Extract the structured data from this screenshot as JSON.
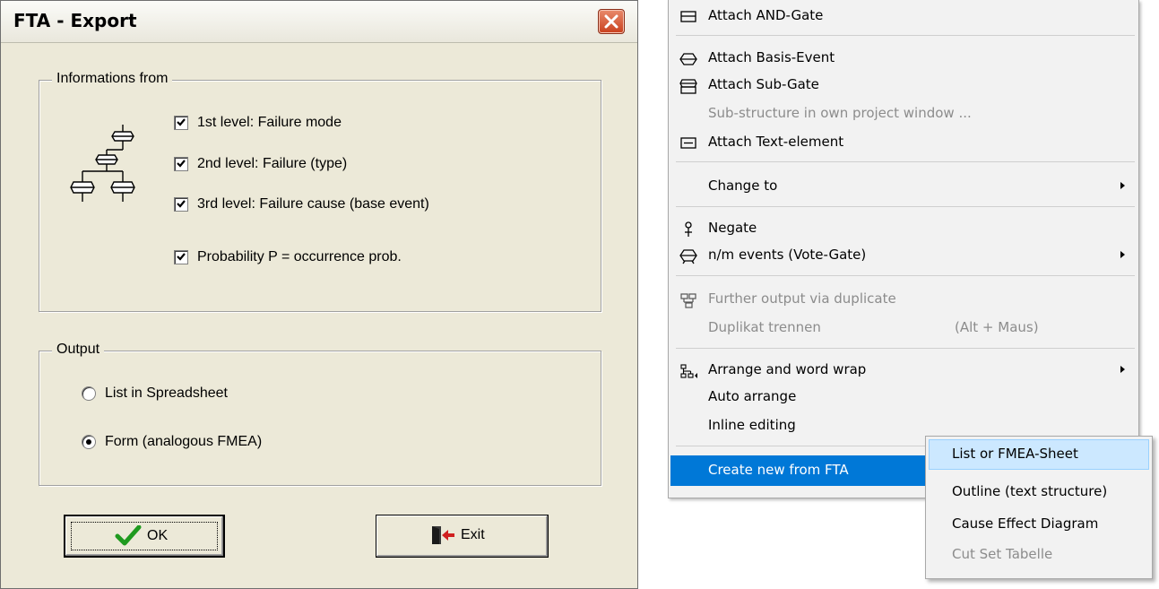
{
  "dialog": {
    "title": "FTA - Export",
    "info_group": {
      "legend": "Informations from",
      "checkboxes": [
        {
          "label": "1st level:  Failure mode",
          "checked": true
        },
        {
          "label": "2nd level: Failure (type)",
          "checked": true
        },
        {
          "label": "3rd level:  Failure cause (base event)",
          "checked": true
        },
        {
          "label": "Probability P = occurrence prob.",
          "checked": true
        }
      ]
    },
    "output_group": {
      "legend": "Output",
      "options": [
        {
          "label": "List in Spreadsheet",
          "selected": false
        },
        {
          "label": "Form (analogous FMEA)",
          "selected": true
        }
      ]
    },
    "ok_label": "OK",
    "exit_label": "Exit"
  },
  "context_menu": {
    "items": [
      {
        "label": "Attach AND-Gate",
        "icon": "and-gate-icon",
        "enabled": true
      },
      {
        "label": "Attach Basis-Event",
        "icon": "basis-event-icon",
        "enabled": true
      },
      {
        "label": "Attach Sub-Gate",
        "icon": "sub-gate-icon",
        "enabled": true
      },
      {
        "label": "Sub-structure in own project window ...",
        "enabled": false
      },
      {
        "label": "Attach Text-element",
        "icon": "text-element-icon",
        "enabled": true
      },
      {
        "label": "Change to",
        "submenu": true,
        "enabled": true
      },
      {
        "label": "Negate",
        "icon": "negate-icon",
        "enabled": true
      },
      {
        "label": "n/m events (Vote-Gate)",
        "icon": "vote-gate-icon",
        "submenu": true,
        "enabled": true
      },
      {
        "label": "Further output via duplicate",
        "icon": "duplicate-icon",
        "enabled": false
      },
      {
        "label": "Duplikat trennen",
        "shortcut": "(Alt + Maus)",
        "enabled": false
      },
      {
        "label": "Arrange and word wrap",
        "icon": "arrange-icon",
        "submenu": true,
        "enabled": true
      },
      {
        "label": "Auto arrange",
        "enabled": true
      },
      {
        "label": "Inline editing",
        "enabled": true
      },
      {
        "label": "Create new from FTA",
        "submenu": true,
        "enabled": true,
        "highlighted": true
      }
    ]
  },
  "submenu": {
    "items": [
      {
        "label": "List or FMEA-Sheet",
        "enabled": true,
        "hovered": true
      },
      {
        "label": "Outline (text structure)",
        "enabled": true
      },
      {
        "label": "Cause Effect Diagram",
        "enabled": true
      },
      {
        "label": "Cut Set Tabelle",
        "enabled": false
      }
    ]
  },
  "colors": {
    "dialog_bg": "#ece9d8",
    "menu_bg": "#f2f2f2",
    "highlight": "#0078d7",
    "hover": "#cce8ff",
    "close_button": "#c9401d",
    "ok_check": "#1f9a1f"
  }
}
